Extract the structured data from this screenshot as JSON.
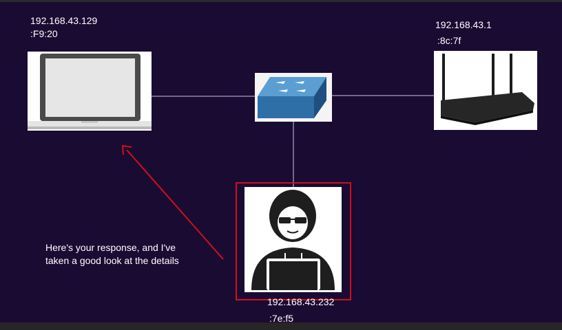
{
  "laptop": {
    "ip": "192.168.43.129",
    "mac": ":F9:20"
  },
  "router": {
    "ip": "192.168.43.1",
    "mac": ":8c:7f"
  },
  "attacker": {
    "ip": "192.168.43.232",
    "mac": ":7e:f5"
  },
  "annotation": {
    "line1": "Here's your response, and I've",
    "line2": "taken a good look at the details"
  },
  "colors": {
    "background": "#1a0b33",
    "arrow": "#d0101a",
    "highlight_border": "#d0101a",
    "wire": "#c8c8d8"
  }
}
